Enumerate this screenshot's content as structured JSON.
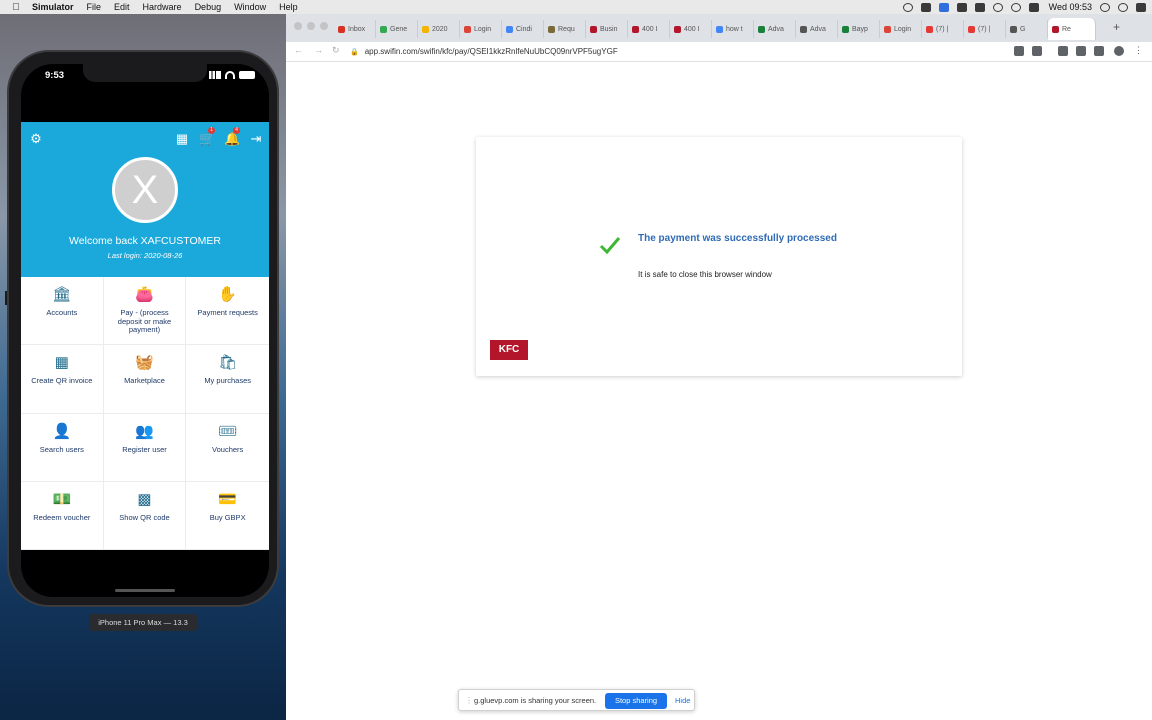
{
  "menubar": {
    "app": "Simulator",
    "items": [
      "File",
      "Edit",
      "Hardware",
      "Debug",
      "Window",
      "Help"
    ],
    "clock": "Wed 09:53"
  },
  "phone": {
    "time": "9:53",
    "welcome": "Welcome back XAFCUSTOMER",
    "last_login": "Last login: 2020-08-26",
    "avatar_letter": "X",
    "cart_badge": "1",
    "bell_badge": "4",
    "tiles": [
      {
        "label": "Accounts",
        "icon": "bank-icon"
      },
      {
        "label": "Pay - (process deposit or make payment)",
        "icon": "wallet-icon"
      },
      {
        "label": "Payment requests",
        "icon": "hand-coin-icon"
      },
      {
        "label": "Create QR invoice",
        "icon": "qr-invoice-icon"
      },
      {
        "label": "Marketplace",
        "icon": "basket-icon"
      },
      {
        "label": "My purchases",
        "icon": "shopping-bag-icon"
      },
      {
        "label": "Search users",
        "icon": "user-search-icon"
      },
      {
        "label": "Register user",
        "icon": "user-add-icon"
      },
      {
        "label": "Vouchers",
        "icon": "ticket-icon"
      },
      {
        "label": "Redeem voucher",
        "icon": "cash-icon"
      },
      {
        "label": "Show QR code",
        "icon": "qr-code-icon"
      },
      {
        "label": "Buy GBPX",
        "icon": "card-icon"
      }
    ],
    "sim_label": "iPhone 11 Pro Max — 13.3"
  },
  "browser": {
    "tabs": [
      {
        "label": "Inbox",
        "color": "#d93025"
      },
      {
        "label": "Gene",
        "color": "#34a853"
      },
      {
        "label": "2020",
        "color": "#f4b400"
      },
      {
        "label": "Login",
        "color": "#db4437"
      },
      {
        "label": "Cindi",
        "color": "#4285f4"
      },
      {
        "label": "Requ",
        "color": "#7a6a3a"
      },
      {
        "label": "Busin",
        "color": "#b3162b"
      },
      {
        "label": "400 I",
        "color": "#b3162b"
      },
      {
        "label": "400 I",
        "color": "#b3162b"
      },
      {
        "label": "how t",
        "color": "#4285f4"
      },
      {
        "label": "Adva",
        "color": "#188038"
      },
      {
        "label": "Adva",
        "color": "#555555"
      },
      {
        "label": "Bayp",
        "color": "#188038"
      },
      {
        "label": "Login",
        "color": "#db4437"
      },
      {
        "label": "(7) |",
        "color": "#e53935"
      },
      {
        "label": "(7) |",
        "color": "#e53935"
      },
      {
        "label": "G",
        "color": "#555555"
      },
      {
        "label": "Re",
        "color": "#b3162b"
      }
    ],
    "url": "app.swifin.com/swifin/kfc/pay/QSEI1kkzRnlfeNuUbCQ09nrVPF5ugYGF",
    "success_title": "The payment was successfully processed",
    "success_sub": "It is safe to close this browser window",
    "brand": "KFC",
    "share": {
      "message": "g.gluevp.com is sharing your screen.",
      "stop": "Stop sharing",
      "hide": "Hide"
    }
  }
}
